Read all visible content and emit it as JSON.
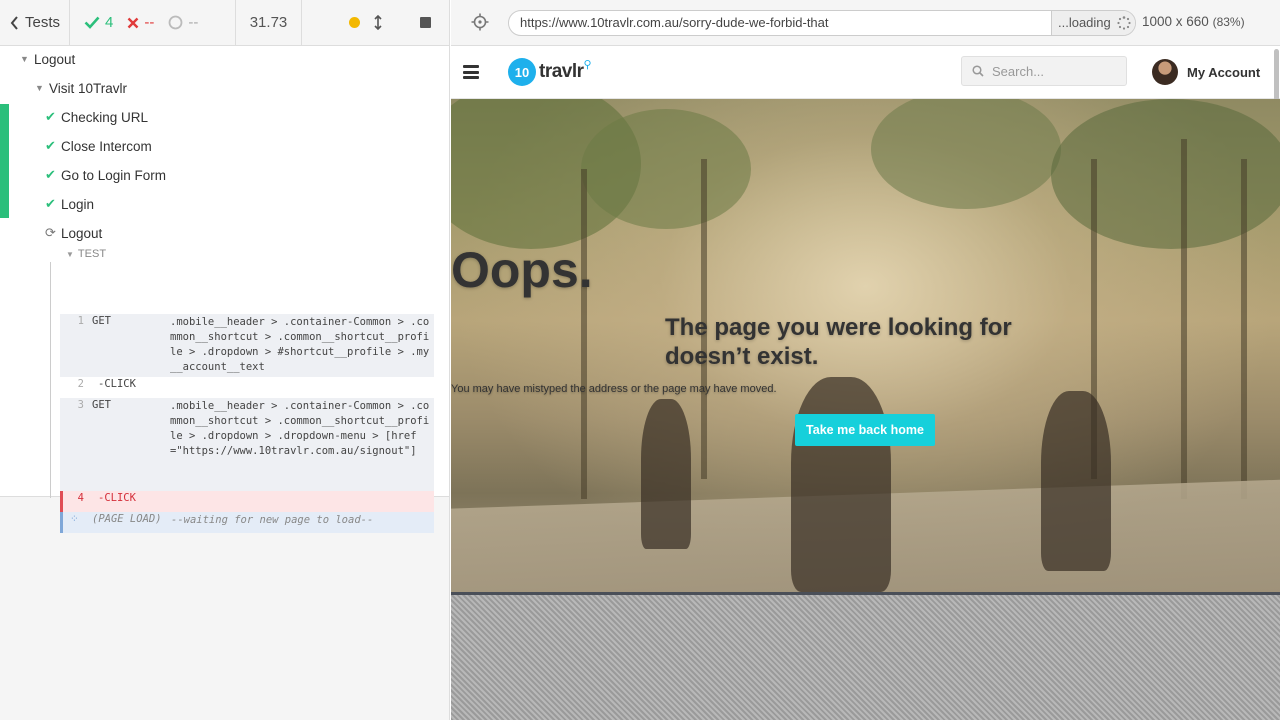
{
  "runner": {
    "tests_label": "Tests",
    "passed": "4",
    "failed": "--",
    "pending": "--",
    "timer": "31.73",
    "tree": {
      "suite": "Logout",
      "describe": "Visit 10Travlr",
      "tests": [
        {
          "label": "Checking URL",
          "state": "passed"
        },
        {
          "label": "Close Intercom",
          "state": "passed"
        },
        {
          "label": "Go to Login Form",
          "state": "passed"
        },
        {
          "label": "Login",
          "state": "passed"
        },
        {
          "label": "Logout",
          "state": "running"
        }
      ]
    },
    "command_log": {
      "section_label": "TEST",
      "commands": [
        {
          "num": "1",
          "name": "GET",
          "message": ".mobile__header > .container-Common > .common__shortcut > .common__shortcut__profile > .dropdown > #shortcut__profile > .my__account__text"
        },
        {
          "num": "2",
          "name": "-CLICK",
          "message": ""
        },
        {
          "num": "3",
          "name": "GET",
          "message": ".mobile__header > .container-Common > .common__shortcut > .common__shortcut__profile > .dropdown > .dropdown-menu > [href=\"https://www.10travlr.com.au/signout\"]"
        },
        {
          "num": "4",
          "name": "-CLICK",
          "message": ""
        },
        {
          "num": "",
          "name": "(PAGE LOAD)",
          "message": "--waiting for new page to load--"
        }
      ]
    }
  },
  "aut": {
    "url": "https://www.10travlr.com.au/sorry-dude-we-forbid-that",
    "loading_label": "...loading",
    "viewport_size": "1000 x 660",
    "scale": "(83%)"
  },
  "site": {
    "logo_mark": "10",
    "logo_text": "travlr",
    "search_placeholder": "Search...",
    "account_label": "My Account",
    "hero": {
      "heading": "Oops.",
      "subheading": "The page you were looking for doesn’t exist.",
      "text": "You may have mistyped the address or the page may have moved.",
      "button_label": "Take me back home"
    }
  },
  "colors": {
    "pass": "#2bbf7b",
    "fail": "#e03b3b",
    "brand": "#1eb0ec",
    "cta": "#16d0db"
  }
}
